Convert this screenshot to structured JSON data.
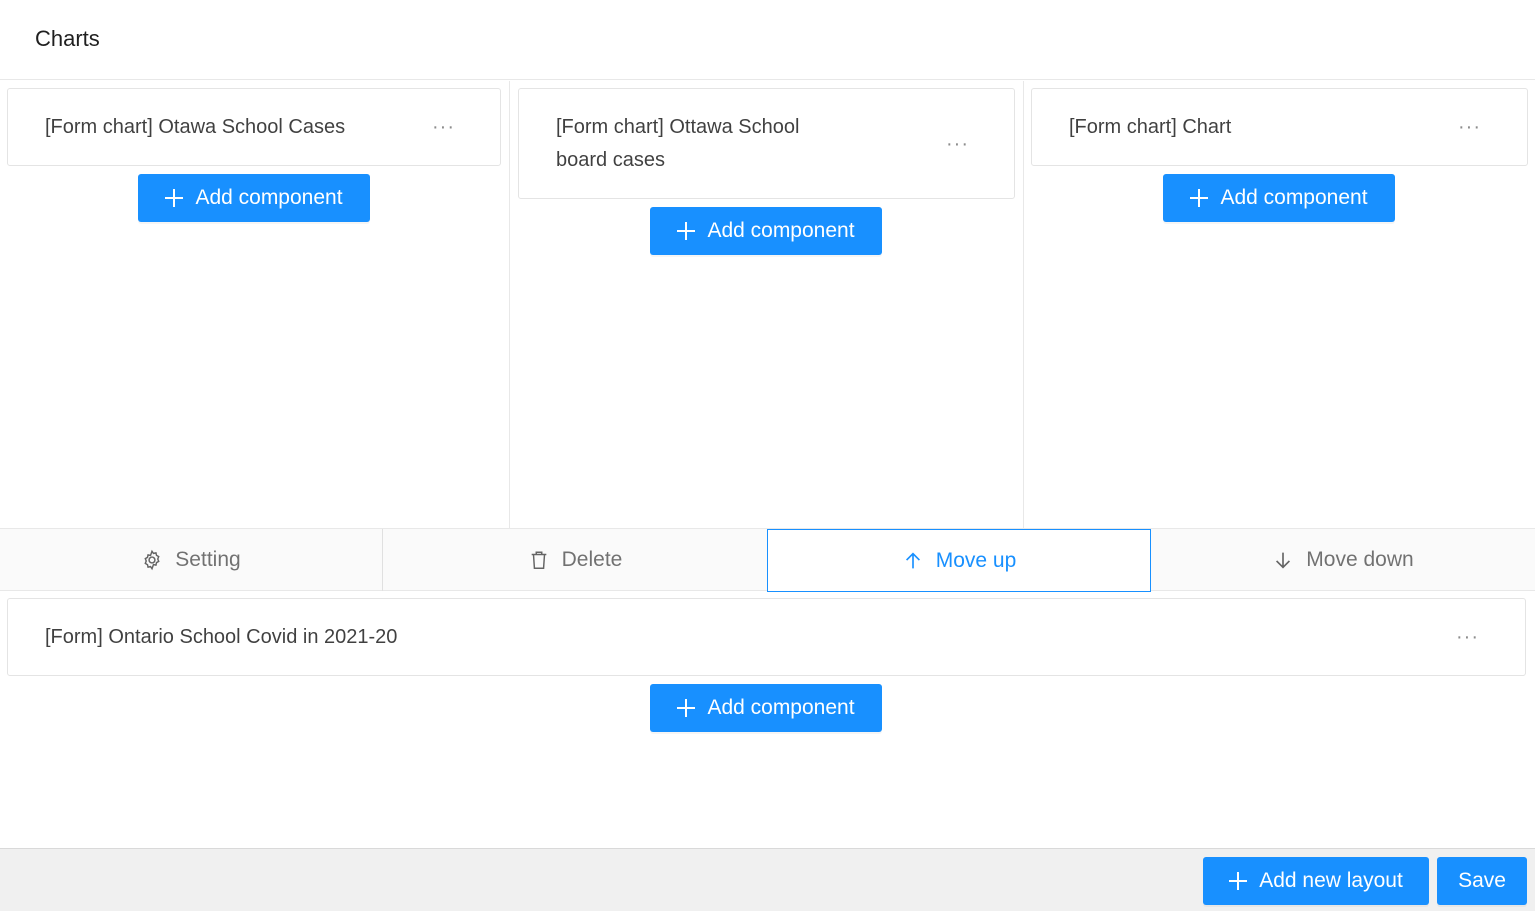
{
  "header": {
    "title": "Charts"
  },
  "row1": {
    "columns": [
      {
        "card_title": "[Form chart] Otawa School Cases",
        "more": "···",
        "add_label": "Add component"
      },
      {
        "card_title_line1": "[Form chart] Ottawa School",
        "card_title_line2": "board cases",
        "more": "···",
        "add_label": "Add component"
      },
      {
        "card_title": "[Form chart] Chart",
        "more": "···",
        "add_label": "Add component"
      }
    ]
  },
  "actions": {
    "setting": "Setting",
    "delete": "Delete",
    "move_up": "Move up",
    "move_down": "Move down"
  },
  "row2": {
    "card_title": "[Form] Ontario School Covid in 2021-20",
    "more": "···",
    "add_label": "Add component"
  },
  "footer": {
    "add_layout_label": "Add new layout",
    "save_label": "Save"
  },
  "colors": {
    "primary": "#1890ff",
    "border": "#e8e8e8",
    "footer_bg": "#f0f0f0"
  }
}
